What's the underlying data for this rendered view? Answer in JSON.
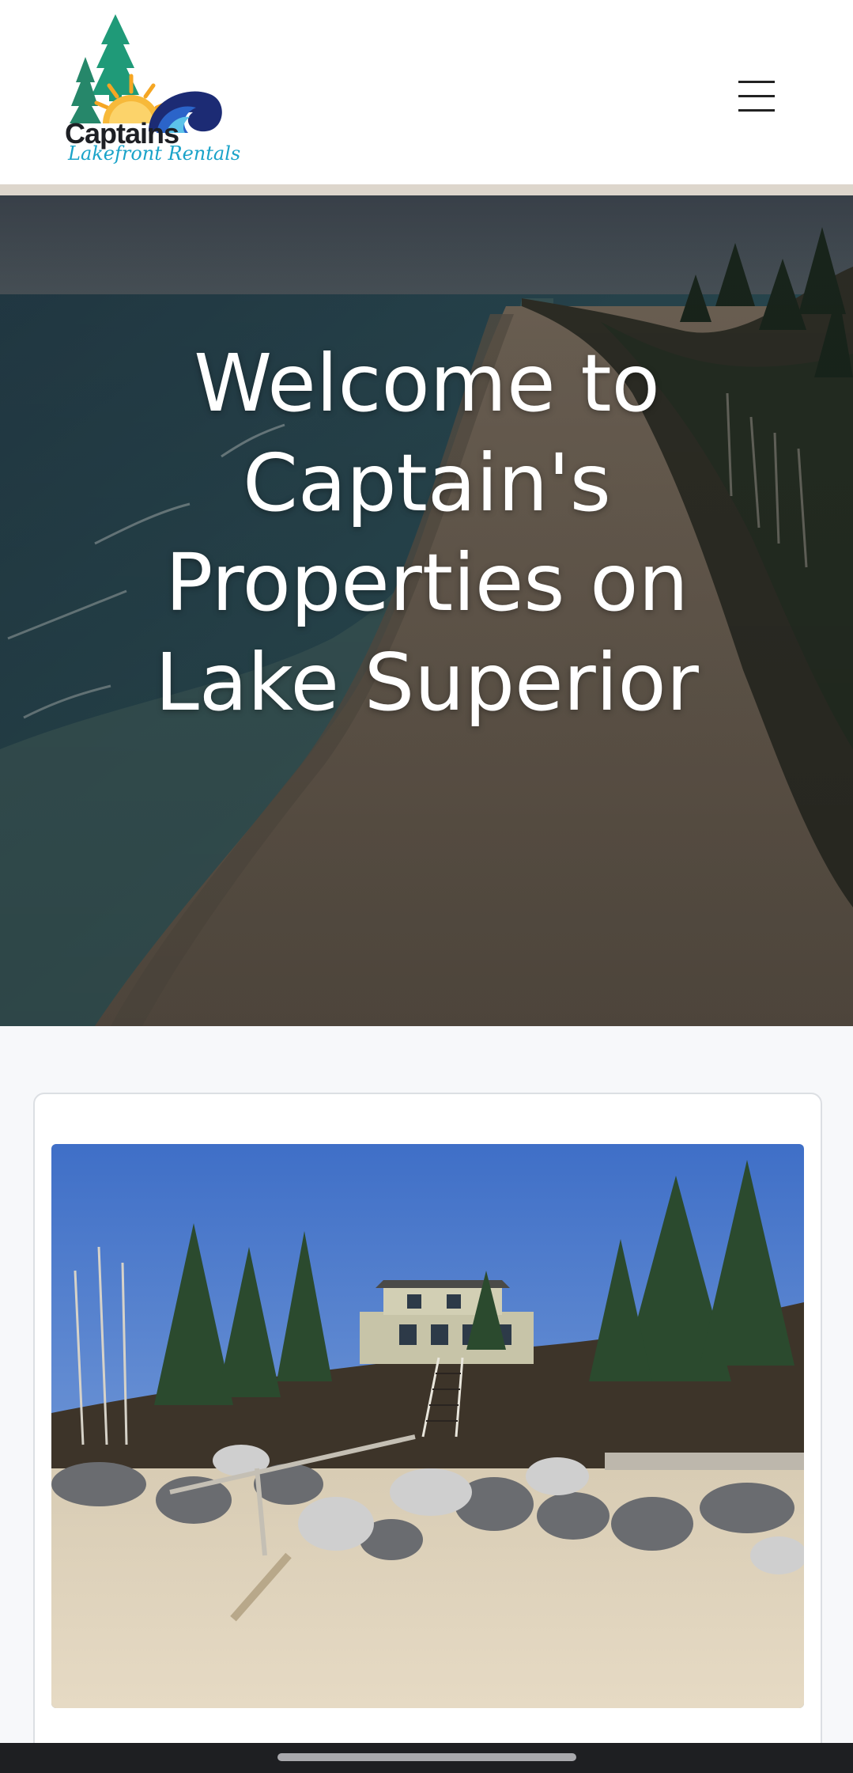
{
  "header": {
    "logo": {
      "brand": "Captains",
      "subtitle": "Lakefront Rentals"
    },
    "menu_icon": "hamburger-menu-icon"
  },
  "hero": {
    "title": "Welcome to Captain's Properties on Lake Superior",
    "image": "aerial-beach-shoreline-photo"
  },
  "featured_card": {
    "image": "lakefront-house-rocky-beach-photo"
  },
  "system": {
    "home_indicator": "home-indicator"
  },
  "colors": {
    "header_bg": "#ffffff",
    "header_strip": "#ddd6cc",
    "page_bg": "#f7f8fa",
    "hero_text": "#ffffff",
    "logo_teal": "#1aa3c9",
    "logo_green": "#1f9a78",
    "logo_sun": "#f5a623",
    "logo_navy": "#1c2b74"
  }
}
